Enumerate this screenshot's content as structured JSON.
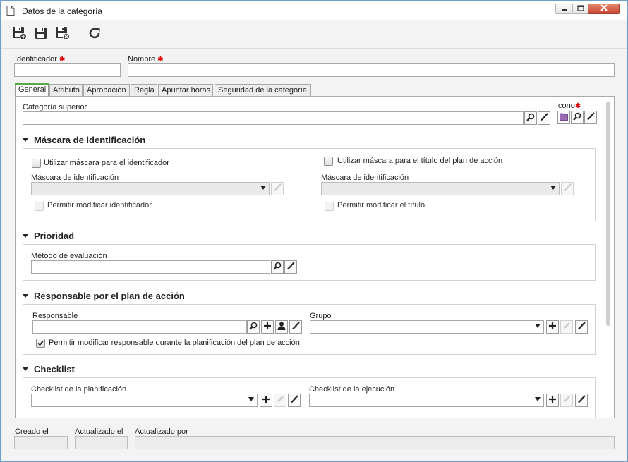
{
  "window": {
    "title": "Datos de la categoría"
  },
  "form": {
    "identifier_label": "Identificador",
    "name_label": "Nombre",
    "identifier_value": "",
    "name_value": ""
  },
  "tabs": [
    {
      "label": "General",
      "active": true
    },
    {
      "label": "Atributo"
    },
    {
      "label": "Aprobación"
    },
    {
      "label": "Regla"
    },
    {
      "label": "Apuntar horas"
    },
    {
      "label": "Seguridad de la categoría"
    }
  ],
  "general": {
    "parent_category_label": "Categoría superior",
    "icon_label": "Icono",
    "id_mask": {
      "title": "Máscara de identificación",
      "use_mask_identifier": "Utilizar máscara para el identificador",
      "use_mask_title": "Utilizar máscara para el título del plan de acción",
      "mask_left_label": "Máscara de identificación",
      "mask_right_label": "Máscara de identificación",
      "allow_modify_identifier": "Permitir modificar identificador",
      "allow_modify_title": "Permitir modificar el título"
    },
    "priority": {
      "title": "Prioridad",
      "evaluation_method_label": "Método de evaluación"
    },
    "responsible": {
      "title": "Responsable por el plan de acción",
      "responsible_label": "Responsable",
      "group_label": "Grupo",
      "allow_modify_label": "Permitir modificar responsable durante la planificación del plan de acción",
      "allow_modify_checked": true
    },
    "checklist": {
      "title": "Checklist",
      "planning_label": "Checklist de la planificación",
      "execution_label": "Checklist de la ejecución"
    }
  },
  "footer": {
    "created_label": "Creado el",
    "updated_label": "Actualizado el",
    "updated_by_label": "Actualizado por"
  },
  "colors": {
    "accent_tab": "#59a84a",
    "required": "#dd0000",
    "close_button": "#c74733"
  }
}
